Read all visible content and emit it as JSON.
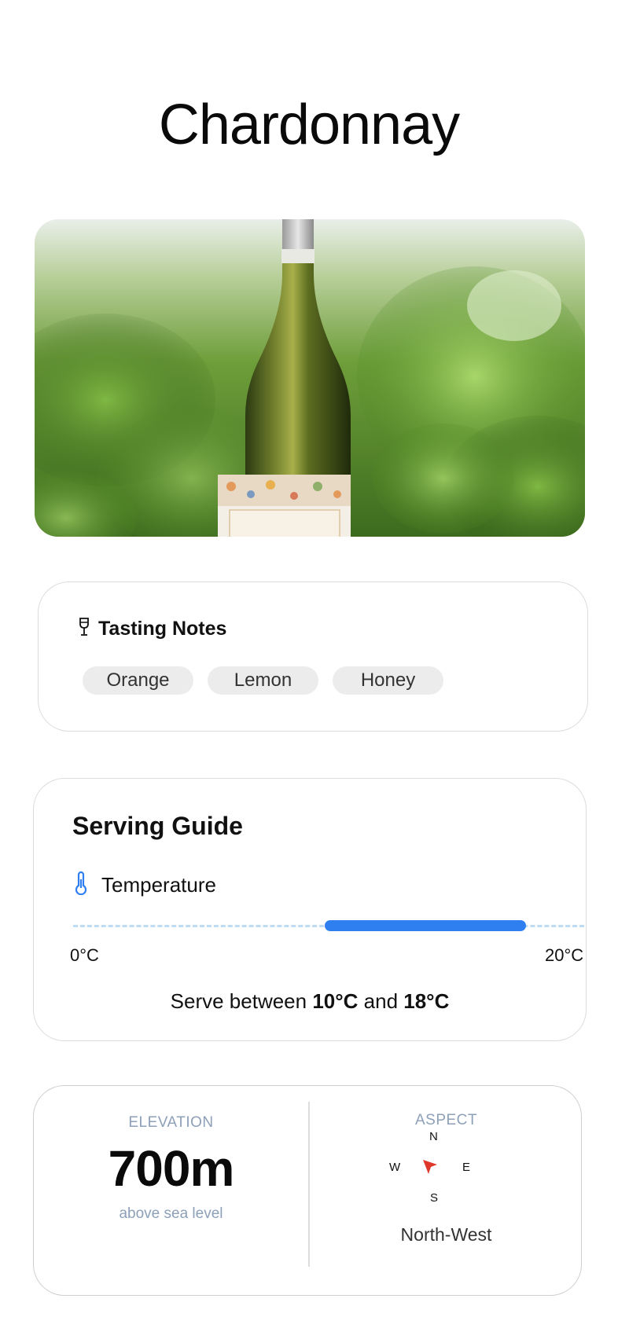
{
  "wine": {
    "name": "Chardonnay"
  },
  "hero": {
    "alt": "Bottle of white wine among vineyard leaves"
  },
  "tasting": {
    "heading": "Tasting Notes",
    "notes": [
      "Orange",
      "Lemon",
      "Honey"
    ]
  },
  "serving": {
    "heading": "Serving Guide",
    "temp_label": "Temperature",
    "scale_min": "0°C",
    "scale_max": "20°C",
    "scale_min_value": 0,
    "scale_max_value": 20,
    "range_low": 10,
    "range_high": 18,
    "text_prefix": "Serve between ",
    "low_text": "10°C",
    "text_mid": " and ",
    "high_text": "18°C"
  },
  "site": {
    "elevation_caption": "ELEVATION",
    "elevation_value": "700m",
    "elevation_sub": "above sea level",
    "aspect_caption": "ASPECT",
    "compass": {
      "n": "N",
      "s": "S",
      "w": "W",
      "e": "E"
    },
    "aspect_value": "North-West"
  },
  "colors": {
    "accent": "#2f7ff0",
    "muted": "#8da0b8",
    "arrow": "#e0372b"
  },
  "icons": {
    "tasting": "wine-glass-icon",
    "temperature": "thermometer-icon",
    "aspect": "navigation-arrow-icon"
  }
}
